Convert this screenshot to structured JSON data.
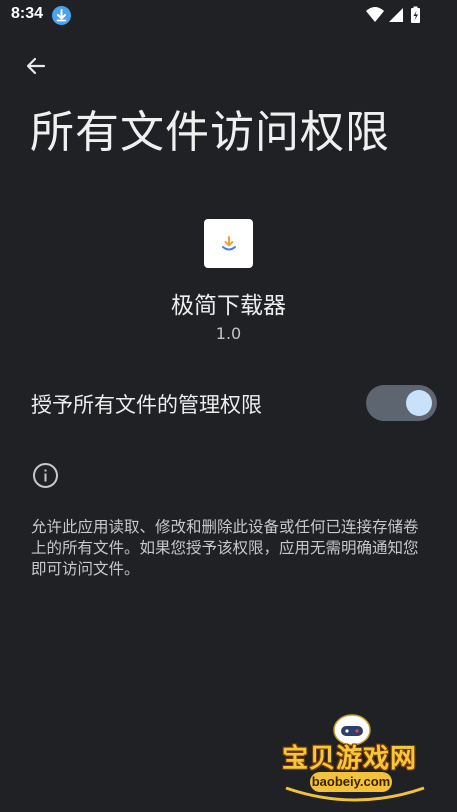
{
  "status_bar": {
    "time": "8:34",
    "icons": [
      "download-notification-icon",
      "wifi-icon",
      "signal-icon",
      "battery-charging-icon"
    ]
  },
  "header": {
    "back_icon": "arrow-left-icon",
    "title": "所有文件访问权限"
  },
  "app": {
    "icon": "download-app-icon",
    "name": "极简下载器",
    "version": "1.0"
  },
  "permission": {
    "label": "授予所有文件的管理权限",
    "toggle_on": true
  },
  "info": {
    "icon": "info-icon",
    "text": "允许此应用读取、修改和删除此设备或任何已连接存储卷上的所有文件。如果您授予该权限，应用无需明确通知您即可访问文件。"
  },
  "watermark": {
    "text": "宝贝游戏网",
    "url": "baobeiy.com"
  },
  "colors": {
    "background": "#1f2125",
    "toggle_track": "#5c6570",
    "toggle_thumb": "#c8e2fb",
    "badge_blue": "#4aa3f0"
  }
}
